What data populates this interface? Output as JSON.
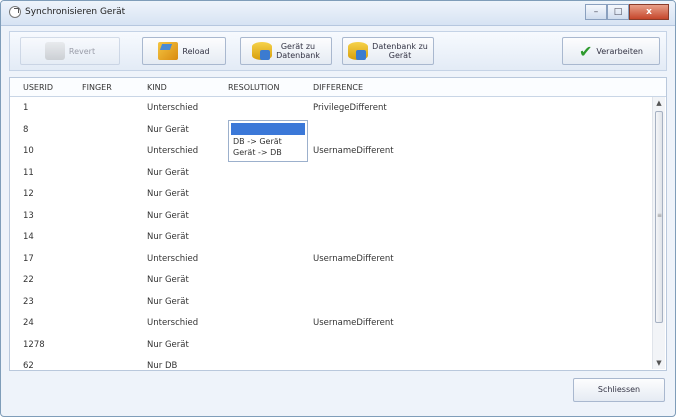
{
  "window": {
    "title": "Synchronisieren Gerät",
    "controls": {
      "minimize": "–",
      "maximize": "□",
      "close": "x"
    }
  },
  "toolbar": {
    "undo_label": "Revert",
    "reload_label": "Reload",
    "device_to_db_label_1": "Gerät zu",
    "device_to_db_label_2": "Datenbank",
    "db_to_device_label_1": "Datenbank zu",
    "db_to_device_label_2": "Gerät",
    "process_label": "Verarbeiten"
  },
  "grid": {
    "columns": [
      "USERID",
      "FINGER",
      "KIND",
      "RESOLUTION",
      "DIFFERENCE"
    ],
    "rows": [
      {
        "userid": "1",
        "kind": "Unterschied",
        "difference": "PrivilegeDifferent"
      },
      {
        "userid": "8",
        "kind": "Nur Gerät",
        "difference": ""
      },
      {
        "userid": "10",
        "kind": "Unterschied",
        "difference": "UsernameDifferent"
      },
      {
        "userid": "11",
        "kind": "Nur Gerät",
        "difference": ""
      },
      {
        "userid": "12",
        "kind": "Nur Gerät",
        "difference": ""
      },
      {
        "userid": "13",
        "kind": "Nur Gerät",
        "difference": ""
      },
      {
        "userid": "14",
        "kind": "Nur Gerät",
        "difference": ""
      },
      {
        "userid": "17",
        "kind": "Unterschied",
        "difference": "UsernameDifferent"
      },
      {
        "userid": "22",
        "kind": "Nur Gerät",
        "difference": ""
      },
      {
        "userid": "23",
        "kind": "Nur Gerät",
        "difference": ""
      },
      {
        "userid": "24",
        "kind": "Unterschied",
        "difference": "UsernameDifferent"
      },
      {
        "userid": "1278",
        "kind": "Nur Gerät",
        "difference": ""
      },
      {
        "userid": "62",
        "kind": "Nur DB",
        "difference": ""
      }
    ]
  },
  "resolution_dropdown": {
    "options": [
      "DB -> Gerät",
      "Gerät -> DB"
    ]
  },
  "footer": {
    "close_label": "Schliessen"
  }
}
